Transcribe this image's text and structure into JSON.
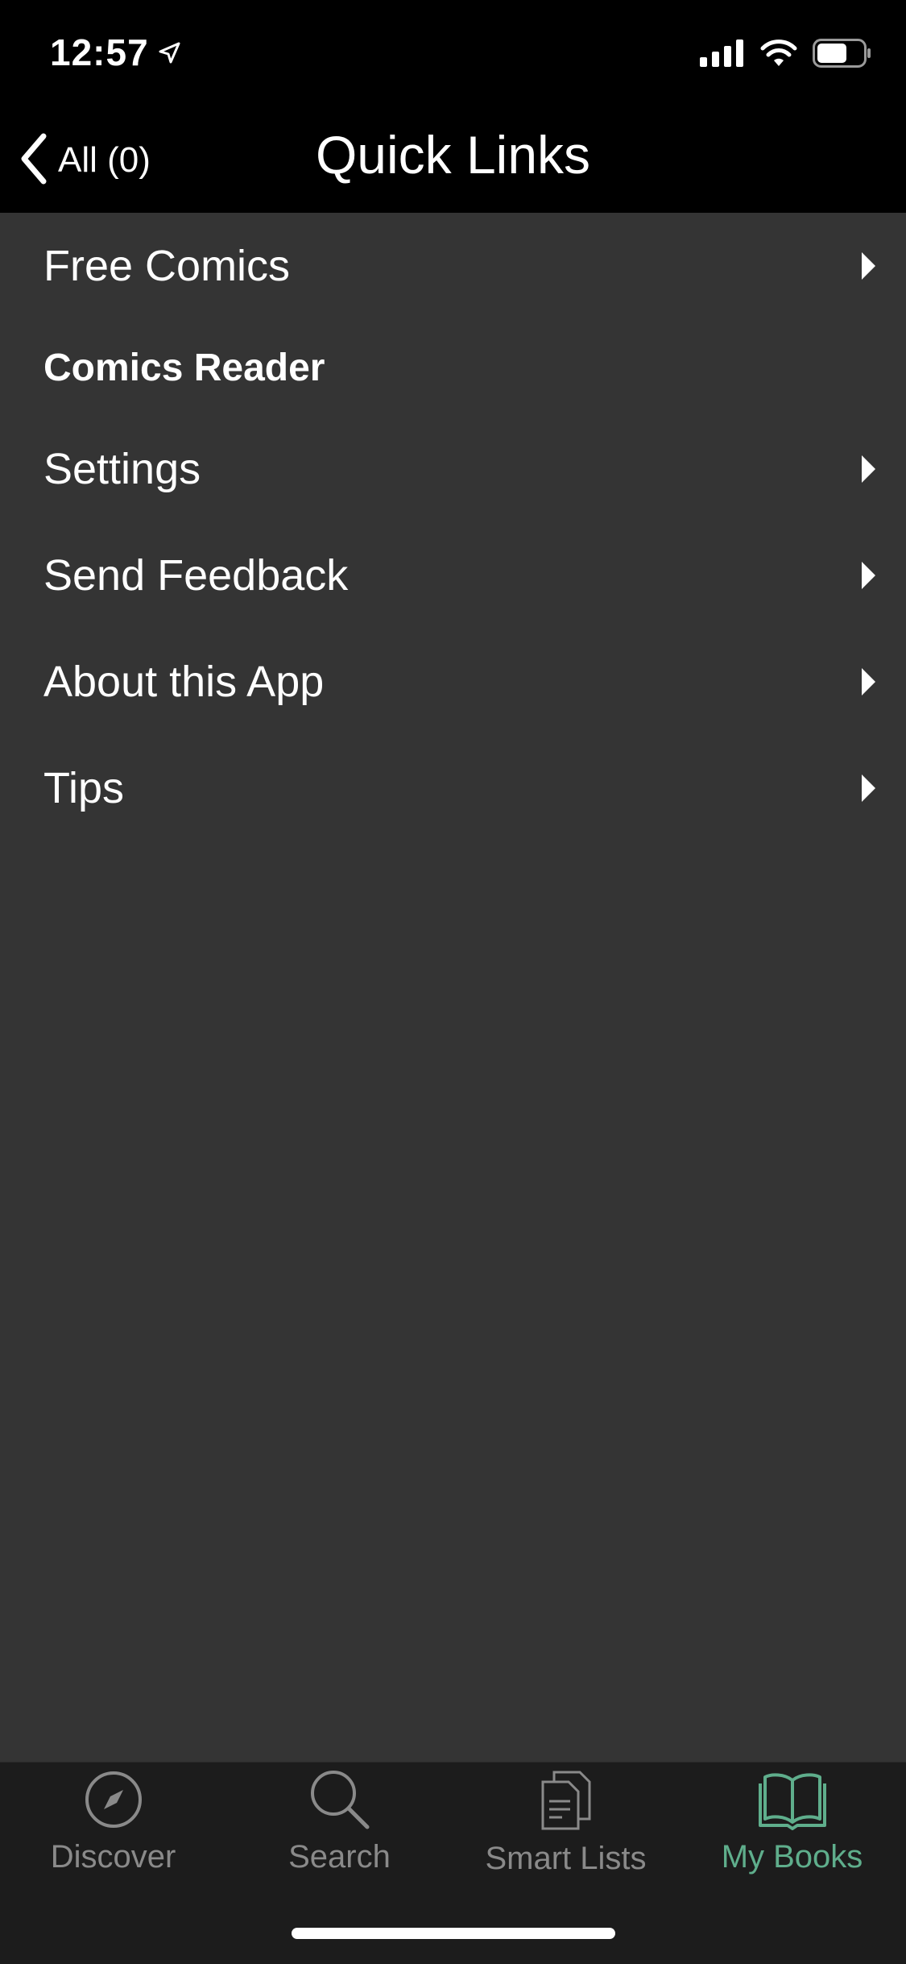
{
  "status_bar": {
    "time": "12:57",
    "icons": [
      "location-arrow-icon",
      "cellular-signal-icon",
      "wifi-icon",
      "battery-icon"
    ]
  },
  "nav": {
    "back_label": "All (0)",
    "title": "Quick Links"
  },
  "menu": {
    "items": [
      {
        "label": "Free Comics",
        "type": "link"
      },
      {
        "label": "Comics Reader",
        "type": "header"
      },
      {
        "label": "Settings",
        "type": "link"
      },
      {
        "label": "Send Feedback",
        "type": "link"
      },
      {
        "label": "About this App",
        "type": "link"
      },
      {
        "label": "Tips",
        "type": "link"
      }
    ]
  },
  "tab_bar": {
    "tabs": [
      {
        "label": "Discover",
        "icon": "compass-icon",
        "active": false
      },
      {
        "label": "Search",
        "icon": "magnifier-icon",
        "active": false
      },
      {
        "label": "Smart Lists",
        "icon": "documents-icon",
        "active": false
      },
      {
        "label": "My Books",
        "icon": "open-book-icon",
        "active": true
      }
    ]
  },
  "colors": {
    "background": "#343434",
    "bars": "#000000",
    "tab_bar": "#1c1c1c",
    "inactive_tab": "#8a8a8a",
    "active_tab": "#5fae8c"
  }
}
